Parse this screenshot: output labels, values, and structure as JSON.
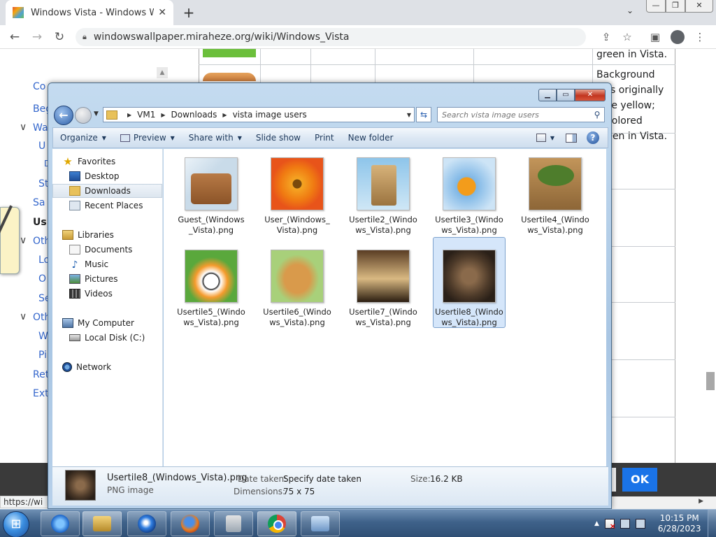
{
  "browser": {
    "tab_title": "Windows Vista - Windows Wallp",
    "url": "windowswallpaper.miraheze.org/wiki/Windows_Vista",
    "status_url": "https://wi"
  },
  "webpage": {
    "toc": [
      "Co",
      "Beg",
      "Wa",
      "U",
      "D",
      "St",
      "Sa",
      "Us",
      "Oth",
      "Lo",
      "O",
      "Se",
      "Oth",
      "W",
      "Pi",
      "Ret",
      "Ext"
    ],
    "row1_text": "green in Vista.",
    "row2_text": "Background was originally pale yellow; recolored green in Vista.",
    "ok_label": "OK"
  },
  "explorer": {
    "breadcrumb": [
      "VM1",
      "Downloads",
      "vista image users"
    ],
    "search_placeholder": "Search vista image users",
    "commands": {
      "organize": "Organize",
      "preview": "Preview",
      "share": "Share with",
      "slideshow": "Slide show",
      "print": "Print",
      "new_folder": "New folder"
    },
    "nav": {
      "favorites": "Favorites",
      "desktop": "Desktop",
      "downloads": "Downloads",
      "recent": "Recent Places",
      "libraries": "Libraries",
      "documents": "Documents",
      "music": "Music",
      "pictures": "Pictures",
      "videos": "Videos",
      "computer": "My Computer",
      "disk": "Local Disk (C:)",
      "network": "Network"
    },
    "files": [
      "Guest_(Windows_Vista).png",
      "User_(Windows_Vista).png",
      "Usertile2_(Windows_Vista).png",
      "Usertile3_(Windows_Vista).png",
      "Usertile4_(Windows_Vista).png",
      "Usertile5_(Windows_Vista).png",
      "Usertile6_(Windows_Vista).png",
      "Usertile7_(Windows_Vista).png",
      "Usertile8_(Windows_Vista).png"
    ],
    "selected_file": "Usertile8_(Windows_Vista).png",
    "details": {
      "name": "Usertile8_(Windows_Vista).png",
      "type": "PNG image",
      "date_label": "Date taken:",
      "date_value": "Specify date taken",
      "dim_label": "Dimensions:",
      "dim_value": "75 x 75",
      "size_label": "Size:",
      "size_value": "16.2 KB"
    }
  },
  "taskbar": {
    "time": "10:15 PM",
    "date": "6/28/2023"
  }
}
